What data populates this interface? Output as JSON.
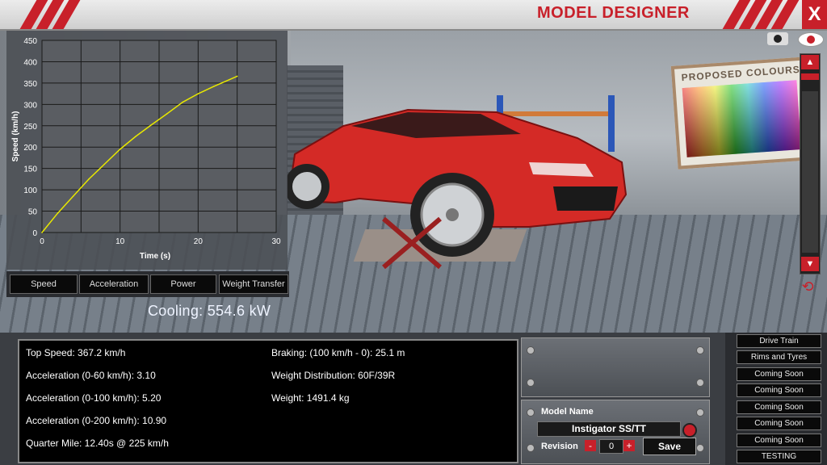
{
  "window": {
    "title": "MODEL DESIGNER",
    "close_label": "X"
  },
  "scene": {
    "board_title": "PROPOSED COLOURS"
  },
  "chart_data": {
    "type": "line",
    "xlabel": "Time (s)",
    "ylabel": "Speed (km/h)",
    "xlim": [
      0,
      30
    ],
    "ylim": [
      0,
      450
    ],
    "xticks": [
      "0",
      "10",
      "20",
      "30"
    ],
    "yticks": [
      "0",
      "50",
      "100",
      "150",
      "200",
      "250",
      "300",
      "350",
      "400",
      "450"
    ],
    "grid": true,
    "series": [
      {
        "color": "#e8e800",
        "x": [
          0,
          2,
          4,
          6,
          8,
          10,
          12,
          14,
          16,
          18,
          20,
          22,
          24,
          25
        ],
        "y": [
          0,
          45,
          85,
          125,
          160,
          195,
          225,
          252,
          278,
          305,
          325,
          342,
          358,
          366
        ]
      }
    ]
  },
  "chart_tabs": [
    "Speed",
    "Acceleration",
    "Power",
    "Weight Transfer"
  ],
  "cooling": "Cooling: 554.6 kW",
  "stats": {
    "top_speed": "Top Speed: 367.2 km/h",
    "accel_60": "Acceleration (0-60 km/h): 3.10",
    "accel_100": "Acceleration (0-100 km/h): 5.20",
    "accel_200": "Acceleration (0-200 km/h): 10.90",
    "quarter_mile": "Quarter Mile: 12.40s @ 225 km/h",
    "braking": "Braking: (100 km/h - 0): 25.1 m",
    "weight_dist": "Weight Distribution: 60F/39R",
    "weight": "Weight: 1491.4 kg"
  },
  "model": {
    "name_label": "Model Name",
    "name_value": "Instigator SS/TT",
    "revision_label": "Revision",
    "revision_value": "0",
    "minus": "-",
    "plus": "+",
    "save_label": "Save"
  },
  "side_menu": [
    "Drive Train",
    "Rims and Tyres",
    "Coming Soon",
    "Coming Soon",
    "Coming Soon",
    "Coming Soon",
    "Coming Soon",
    "TESTING"
  ],
  "colors": {
    "accent": "#c8202a",
    "curve": "#e8e800"
  }
}
